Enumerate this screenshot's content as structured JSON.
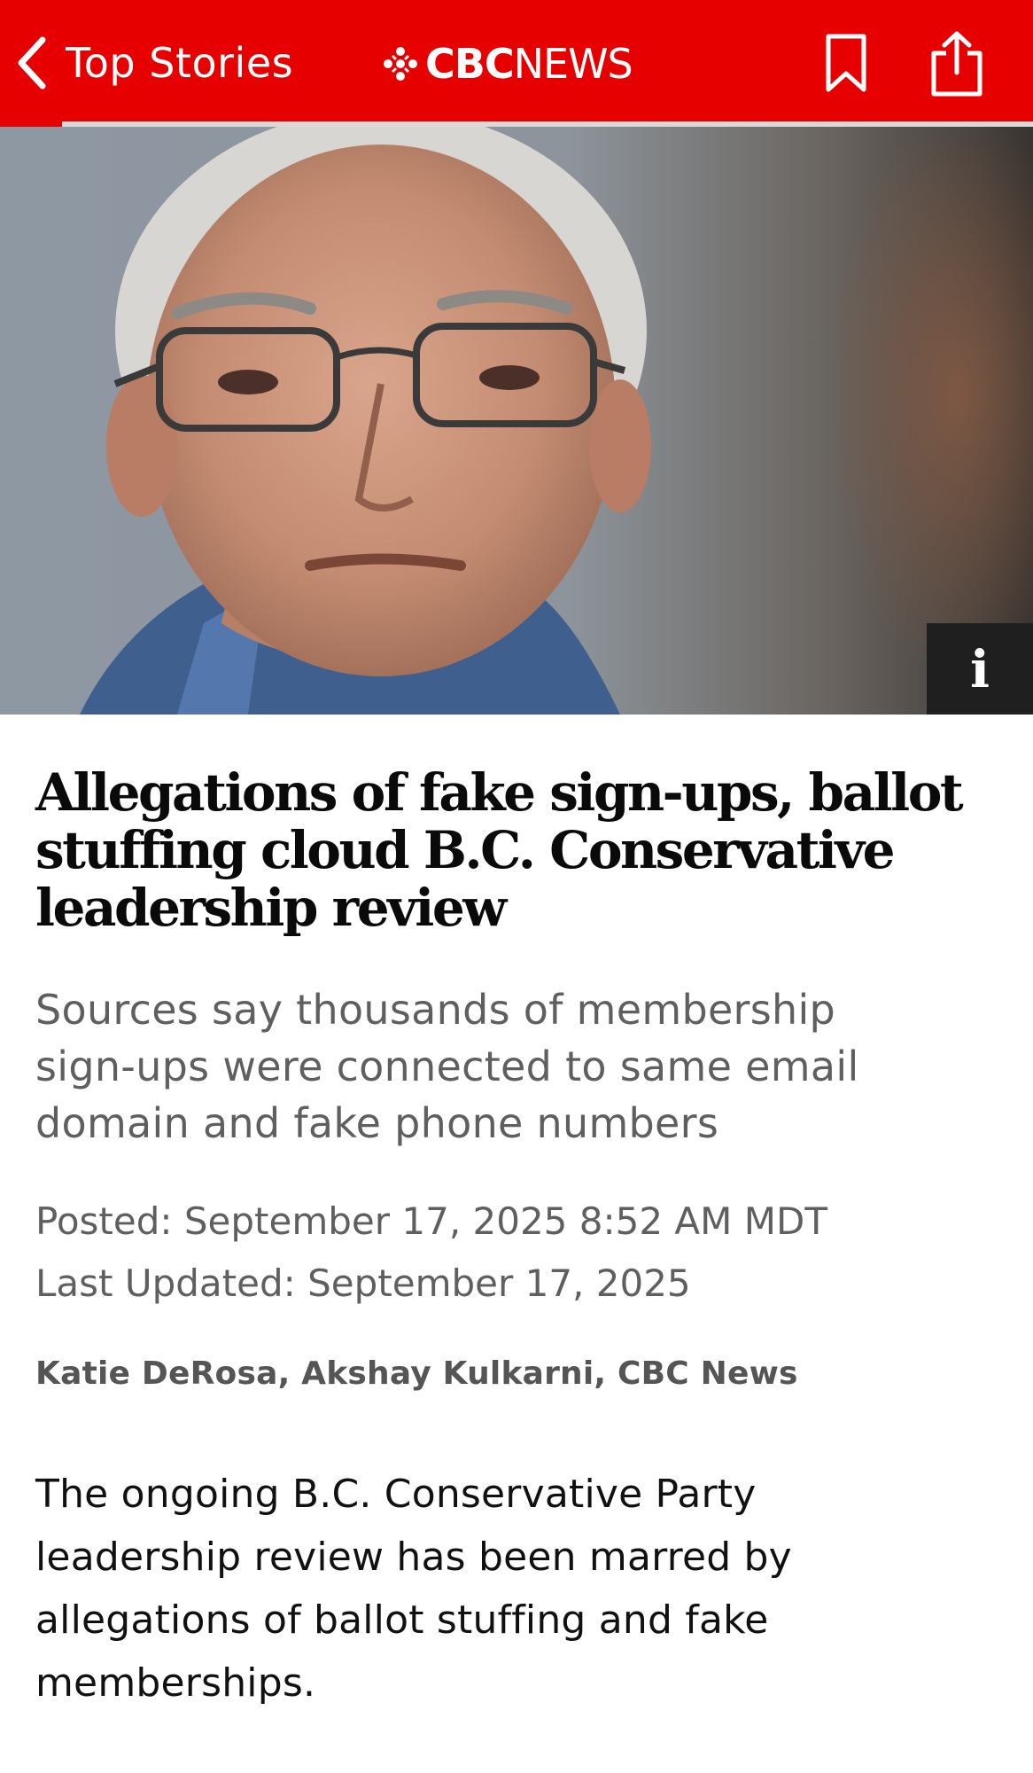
{
  "header": {
    "back_label": "Top Stories",
    "brand_cbc": "CBC",
    "brand_news": "NEWS",
    "bar_color": "#e60000",
    "icons": [
      "back-chevron-icon",
      "cbc-gem-icon",
      "bookmark-icon",
      "share-icon"
    ],
    "reading_progress": 0.06
  },
  "hero": {
    "info_label": "i"
  },
  "article": {
    "headline": "Allegations of fake sign-ups, ballot stuffing cloud B.C. Conservative leadership review",
    "deck": "Sources say thousands of membership sign-ups were connected to same email domain and fake phone numbers",
    "posted": "Posted: September 17, 2025 8:52 AM MDT",
    "updated": "Last Updated: September 17, 2025",
    "authors": [
      "Katie DeRosa",
      "Akshay Kulkarni",
      "CBC News"
    ],
    "author_separator": ", ",
    "body": "The ongoing B.C. Conservative Party leadership review has been marred by allegations of ballot stuffing and fake memberships."
  }
}
